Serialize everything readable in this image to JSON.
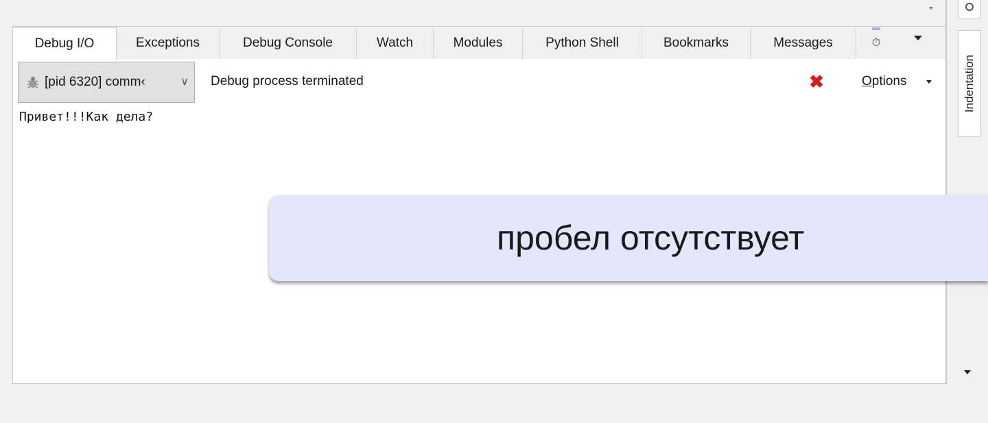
{
  "tabs": [
    {
      "label": "Debug I/O",
      "active": true
    },
    {
      "label": "Exceptions"
    },
    {
      "label": "Debug Console"
    },
    {
      "label": "Watch"
    },
    {
      "label": "Modules"
    },
    {
      "label": "Python Shell"
    },
    {
      "label": "Bookmarks"
    },
    {
      "label": "Messages"
    }
  ],
  "toolbar": {
    "process_select": "[pid 6320] comm‹",
    "status": "Debug process terminated",
    "options_label": "Options"
  },
  "output": {
    "text": "Привет!!!Как дела?"
  },
  "side_panel": {
    "tab_label": "Indentation"
  },
  "callout": {
    "text": "пробел отсутствует",
    "color": "#e4e6fb"
  },
  "colors": {
    "stop": "#d41a1a"
  }
}
